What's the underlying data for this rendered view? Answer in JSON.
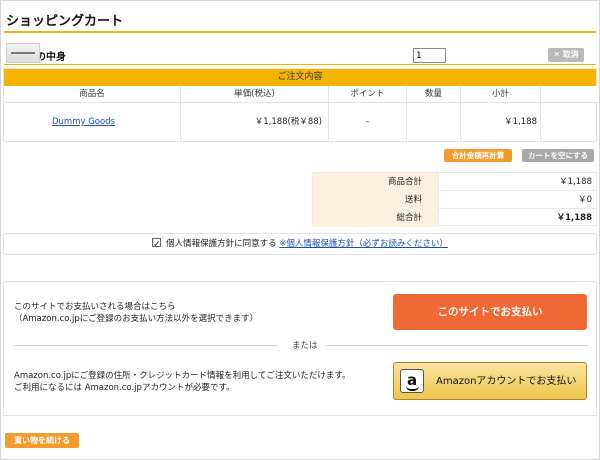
{
  "page": {
    "title": "ショッピングカート"
  },
  "cart": {
    "section_title": "カートの中身",
    "order_header": "ご注文内容",
    "columns": [
      "商品名",
      "単価(税込)",
      "ポイント",
      "数量",
      "小計"
    ],
    "item": {
      "name": "Dummy Goods",
      "unit_price": "￥1,188(税￥88)",
      "points": "-",
      "quantity": "1",
      "subtotal": "￥1,188",
      "cancel_label": "✕ 取消"
    },
    "recalc_label": "合計金額再計算",
    "empty_label": "カートを空にする"
  },
  "totals": {
    "rows": [
      {
        "label": "商品合計",
        "value": "￥1,188"
      },
      {
        "label": "送料",
        "value": "￥0"
      },
      {
        "label": "総合計",
        "value": "￥1,188"
      }
    ]
  },
  "consent": {
    "text": "個人情報保護方針に同意する",
    "link": "※個人情報保護方針（必ずお読みください）",
    "checked": true
  },
  "payment": {
    "site_text_1": "このサイトでお支払いされる場合はこちら",
    "site_text_2": "（Amazon.co.jpにご登録のお支払い方法以外を選択できます）",
    "site_button": "このサイトでお支払い",
    "or_text": "または",
    "amazon_text_1": "Amazon.co.jpにご登録の住所・クレジットカード情報を利用してご注文いただけます。",
    "amazon_text_2": "ご利用になるには Amazon.co.jpアカウントが必要です。",
    "amazon_button": "Amazonアカウントでお支払い",
    "amazon_logo_letter": "a"
  },
  "footer": {
    "continue_label": "買い物を続ける"
  },
  "colors": {
    "accent": "#f5b400",
    "site_pay_button": "#f06935",
    "small_orange_button": "#f39c2d",
    "link": "#1a4fb3",
    "totals_label_bg": "#fbf0dd"
  }
}
